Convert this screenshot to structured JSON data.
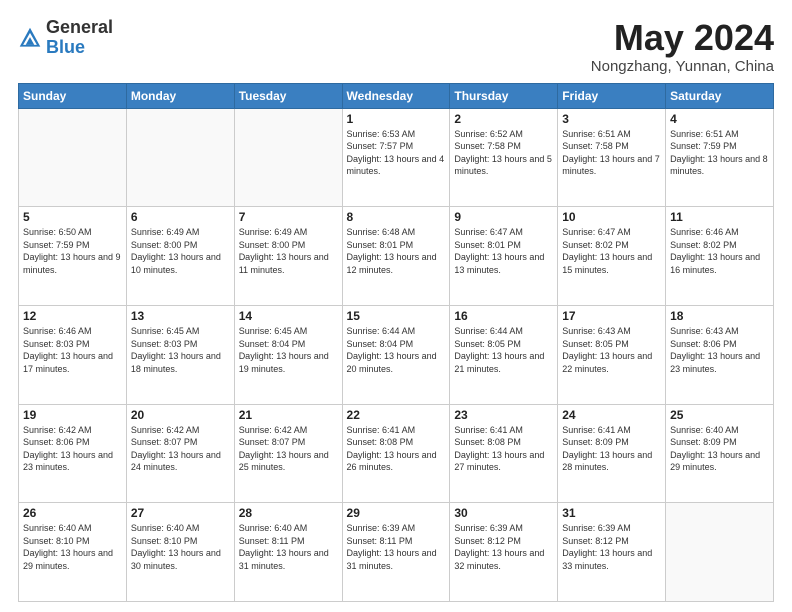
{
  "header": {
    "logo_general": "General",
    "logo_blue": "Blue",
    "month_year": "May 2024",
    "location": "Nongzhang, Yunnan, China"
  },
  "weekdays": [
    "Sunday",
    "Monday",
    "Tuesday",
    "Wednesday",
    "Thursday",
    "Friday",
    "Saturday"
  ],
  "weeks": [
    [
      {
        "day": "",
        "info": ""
      },
      {
        "day": "",
        "info": ""
      },
      {
        "day": "",
        "info": ""
      },
      {
        "day": "1",
        "info": "Sunrise: 6:53 AM\nSunset: 7:57 PM\nDaylight: 13 hours and 4 minutes."
      },
      {
        "day": "2",
        "info": "Sunrise: 6:52 AM\nSunset: 7:58 PM\nDaylight: 13 hours and 5 minutes."
      },
      {
        "day": "3",
        "info": "Sunrise: 6:51 AM\nSunset: 7:58 PM\nDaylight: 13 hours and 7 minutes."
      },
      {
        "day": "4",
        "info": "Sunrise: 6:51 AM\nSunset: 7:59 PM\nDaylight: 13 hours and 8 minutes."
      }
    ],
    [
      {
        "day": "5",
        "info": "Sunrise: 6:50 AM\nSunset: 7:59 PM\nDaylight: 13 hours and 9 minutes."
      },
      {
        "day": "6",
        "info": "Sunrise: 6:49 AM\nSunset: 8:00 PM\nDaylight: 13 hours and 10 minutes."
      },
      {
        "day": "7",
        "info": "Sunrise: 6:49 AM\nSunset: 8:00 PM\nDaylight: 13 hours and 11 minutes."
      },
      {
        "day": "8",
        "info": "Sunrise: 6:48 AM\nSunset: 8:01 PM\nDaylight: 13 hours and 12 minutes."
      },
      {
        "day": "9",
        "info": "Sunrise: 6:47 AM\nSunset: 8:01 PM\nDaylight: 13 hours and 13 minutes."
      },
      {
        "day": "10",
        "info": "Sunrise: 6:47 AM\nSunset: 8:02 PM\nDaylight: 13 hours and 15 minutes."
      },
      {
        "day": "11",
        "info": "Sunrise: 6:46 AM\nSunset: 8:02 PM\nDaylight: 13 hours and 16 minutes."
      }
    ],
    [
      {
        "day": "12",
        "info": "Sunrise: 6:46 AM\nSunset: 8:03 PM\nDaylight: 13 hours and 17 minutes."
      },
      {
        "day": "13",
        "info": "Sunrise: 6:45 AM\nSunset: 8:03 PM\nDaylight: 13 hours and 18 minutes."
      },
      {
        "day": "14",
        "info": "Sunrise: 6:45 AM\nSunset: 8:04 PM\nDaylight: 13 hours and 19 minutes."
      },
      {
        "day": "15",
        "info": "Sunrise: 6:44 AM\nSunset: 8:04 PM\nDaylight: 13 hours and 20 minutes."
      },
      {
        "day": "16",
        "info": "Sunrise: 6:44 AM\nSunset: 8:05 PM\nDaylight: 13 hours and 21 minutes."
      },
      {
        "day": "17",
        "info": "Sunrise: 6:43 AM\nSunset: 8:05 PM\nDaylight: 13 hours and 22 minutes."
      },
      {
        "day": "18",
        "info": "Sunrise: 6:43 AM\nSunset: 8:06 PM\nDaylight: 13 hours and 23 minutes."
      }
    ],
    [
      {
        "day": "19",
        "info": "Sunrise: 6:42 AM\nSunset: 8:06 PM\nDaylight: 13 hours and 23 minutes."
      },
      {
        "day": "20",
        "info": "Sunrise: 6:42 AM\nSunset: 8:07 PM\nDaylight: 13 hours and 24 minutes."
      },
      {
        "day": "21",
        "info": "Sunrise: 6:42 AM\nSunset: 8:07 PM\nDaylight: 13 hours and 25 minutes."
      },
      {
        "day": "22",
        "info": "Sunrise: 6:41 AM\nSunset: 8:08 PM\nDaylight: 13 hours and 26 minutes."
      },
      {
        "day": "23",
        "info": "Sunrise: 6:41 AM\nSunset: 8:08 PM\nDaylight: 13 hours and 27 minutes."
      },
      {
        "day": "24",
        "info": "Sunrise: 6:41 AM\nSunset: 8:09 PM\nDaylight: 13 hours and 28 minutes."
      },
      {
        "day": "25",
        "info": "Sunrise: 6:40 AM\nSunset: 8:09 PM\nDaylight: 13 hours and 29 minutes."
      }
    ],
    [
      {
        "day": "26",
        "info": "Sunrise: 6:40 AM\nSunset: 8:10 PM\nDaylight: 13 hours and 29 minutes."
      },
      {
        "day": "27",
        "info": "Sunrise: 6:40 AM\nSunset: 8:10 PM\nDaylight: 13 hours and 30 minutes."
      },
      {
        "day": "28",
        "info": "Sunrise: 6:40 AM\nSunset: 8:11 PM\nDaylight: 13 hours and 31 minutes."
      },
      {
        "day": "29",
        "info": "Sunrise: 6:39 AM\nSunset: 8:11 PM\nDaylight: 13 hours and 31 minutes."
      },
      {
        "day": "30",
        "info": "Sunrise: 6:39 AM\nSunset: 8:12 PM\nDaylight: 13 hours and 32 minutes."
      },
      {
        "day": "31",
        "info": "Sunrise: 6:39 AM\nSunset: 8:12 PM\nDaylight: 13 hours and 33 minutes."
      },
      {
        "day": "",
        "info": ""
      }
    ]
  ]
}
